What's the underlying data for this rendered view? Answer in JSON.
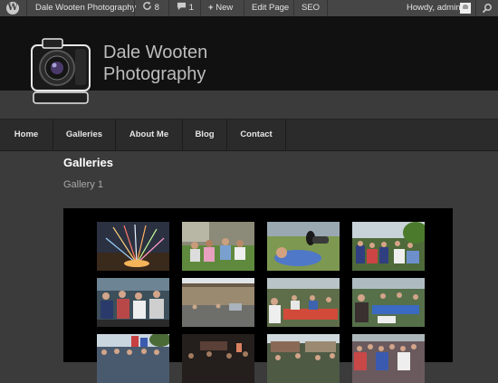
{
  "adminbar": {
    "site_name": "Dale Wooten Photography",
    "updates_count": "8",
    "comments_count": "1",
    "new_label": "New",
    "edit_page_label": "Edit Page",
    "seo_label": "SEO",
    "howdy_label": "Howdy, admin"
  },
  "header": {
    "title_line1": "Dale Wooten",
    "title_line2": "Photography"
  },
  "nav": {
    "items": [
      "Home",
      "Galleries",
      "About Me",
      "Blog",
      "Contact"
    ]
  },
  "main": {
    "page_title": "Galleries",
    "gallery_title": "Gallery 1"
  },
  "gallery": {
    "thumbnails": [
      "fireworks",
      "crowd-seated-outdoors",
      "person-lying-on-grass",
      "crowd-under-trees",
      "crowd-watching",
      "building-parking-lot",
      "people-at-tables",
      "crowd-tables",
      "crowd-flags",
      "night-event",
      "crowd-buildings",
      "crowd-large"
    ]
  },
  "colors": {
    "page_bg": "#3b3b3b",
    "adminbar_bg": "#464646",
    "header_bg": "#111111",
    "nav_bg": "#2b2b2b"
  }
}
